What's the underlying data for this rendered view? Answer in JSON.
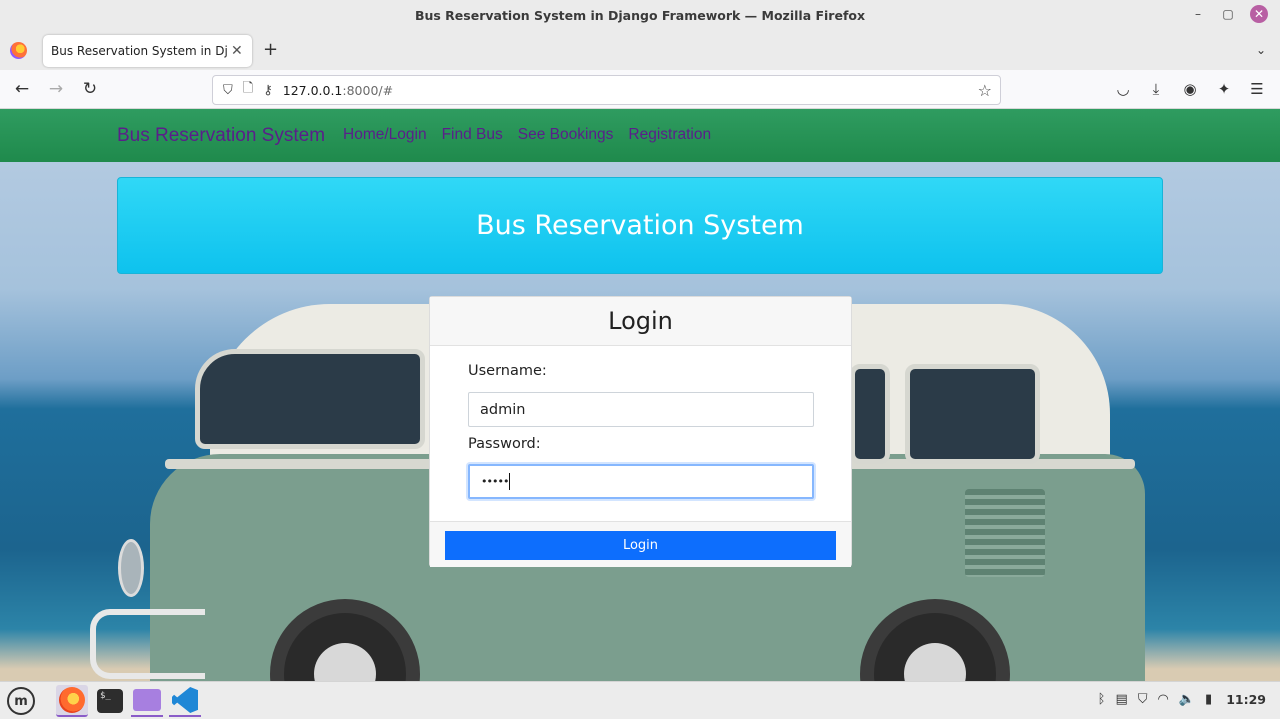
{
  "window": {
    "title": "Bus Reservation System in Django Framework — Mozilla Firefox",
    "controls": {
      "minimize": "–",
      "maximize": "▢",
      "close": "✕"
    }
  },
  "tabs": [
    {
      "label": "Bus Reservation System in Djan",
      "close": "✕"
    }
  ],
  "tabbar": {
    "new_tab": "+",
    "list_all": "⌄"
  },
  "navbar": {
    "back": "←",
    "forward": "→",
    "reload": "↻",
    "url_host": "127.0.0.1",
    "url_rest": ":8000/#",
    "bookmark": "☆",
    "icons": [
      "pocket-icon",
      "downloads-icon",
      "account-icon",
      "extensions-icon",
      "menu-icon"
    ]
  },
  "site": {
    "brand": "Bus Reservation System",
    "links": [
      "Home/Login",
      "Find Bus",
      "See Bookings",
      "Registration"
    ],
    "banner_title": "Bus Reservation System"
  },
  "login": {
    "heading": "Login",
    "username_label": "Username:",
    "username_value": "admin",
    "password_label": "Password:",
    "password_value": "•••••",
    "submit_label": "Login"
  },
  "taskbar": {
    "apps": [
      "mint-menu-icon",
      "firefox-icon",
      "terminal-icon",
      "files-icon",
      "vscode-icon"
    ],
    "terminal_prompt": "$_",
    "clock": "11:29"
  },
  "colors": {
    "site_nav": "#1f8a4c",
    "nav_link": "#5a1f8a",
    "banner": "#1ec8f0",
    "primary_button": "#0d6efd"
  }
}
